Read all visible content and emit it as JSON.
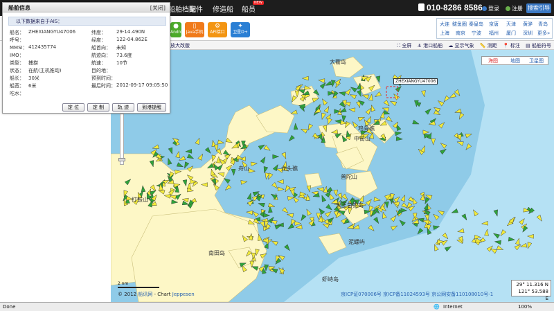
{
  "topbar": {
    "nav": [
      "船舶档案",
      "配件",
      "修造船",
      "船员"
    ],
    "new_badge": "NEW",
    "phone": "010-8286 8586",
    "login": "登录",
    "register": "注册",
    "tour_button": "搜索引导"
  },
  "app_buttons": [
    {
      "label": "Android",
      "color": "#4caa2a",
      "glyph": "●"
    },
    {
      "label": "Java手机",
      "color": "#f07a1a",
      "glyph": "▯"
    },
    {
      "label": "API接口",
      "color": "#f39512",
      "glyph": "⚙"
    },
    {
      "label": "卫星D+",
      "color": "#2a7fd4",
      "glyph": "✦"
    }
  ],
  "cities": {
    "row1": [
      "大连",
      "鲅鱼圈",
      "秦皇岛",
      "京唐",
      "天津",
      "黄骅",
      "青岛"
    ],
    "row2": [
      "上海",
      "南京",
      "宁波",
      "福州",
      "厦门",
      "深圳",
      "更多»"
    ]
  },
  "map_toolbar": {
    "left": "放大改版",
    "items": [
      "全屏",
      "港口船舶",
      "显示气象",
      "测距",
      "标注",
      "船舶符号"
    ]
  },
  "map_type": {
    "options": [
      "海图",
      "地图",
      "卫星图"
    ],
    "selected": "海图"
  },
  "popup": {
    "title": "船舶信息",
    "close": "[关闭]",
    "source": "以下数据来自于AIS：",
    "left_fields": [
      {
        "label": "船名：",
        "value": "ZHEXIANGYU47006"
      },
      {
        "label": "呼号：",
        "value": ""
      },
      {
        "label": "MMSI：",
        "value": "412435774"
      },
      {
        "label": "IMO：",
        "value": ""
      },
      {
        "label": "类型：",
        "value": "捕捞"
      },
      {
        "label": "状态：",
        "value": "在航(主机推动)"
      },
      {
        "label": "船长：",
        "value": "30米"
      },
      {
        "label": "船宽：",
        "value": "6米"
      },
      {
        "label": "吃水：",
        "value": ""
      }
    ],
    "right_fields": [
      {
        "label": "纬度：",
        "value": "29-14.490N"
      },
      {
        "label": "经度：",
        "value": "122-04.862E"
      },
      {
        "label": "船首向：",
        "value": "未知"
      },
      {
        "label": "航迹向：",
        "value": "73.6度"
      },
      {
        "label": "航速：",
        "value": "10节"
      },
      {
        "label": "目的地：",
        "value": ""
      },
      {
        "label": "预到时间：",
        "value": ""
      },
      {
        "label": "最后时间：",
        "value": "2012-09-17 09:05:50"
      }
    ],
    "buttons": [
      "定 位",
      "定 制",
      "轨 迹",
      "到港提醒"
    ]
  },
  "map_labels": {
    "islands": [
      "大衢岛",
      "鸡骨礁",
      "中街山",
      "龙头礁",
      "普陀山",
      "舟山",
      "嵊泗",
      "六横岛",
      "大王首钓岛",
      "泥螺屿",
      "南田岛",
      "打鼓山",
      "虾峙岛",
      "沙鳗屿",
      "檀头山",
      "南韭山"
    ],
    "ship_tag": "ZHEXIANGYU47006"
  },
  "map_controls": {
    "pan_arrows": [
      "↑",
      "←",
      "→",
      "↓"
    ],
    "zoom_in": "+",
    "zoom_out": "−"
  },
  "scale": "2 nm",
  "copyright": {
    "prefix": "© 2012",
    "site": "船讯网",
    "chart": "- Chart",
    "provider": "Jeppesen"
  },
  "icp": "京ICP证070006号 京ICP备11024593号 京公网安备110108010号-1",
  "coords": {
    "lat": "29° 11.316 N",
    "lon": "121° 53.588 E"
  },
  "status": {
    "left": "Done",
    "zone": "Internet",
    "zoom": "100%"
  },
  "colors": {
    "topbar": "#1d1d1d",
    "sea_deep": "#b5e1f4",
    "sea_shallow": "#8fcbe8",
    "land": "#fdf7c6",
    "ship": "#f2ea3a",
    "accent": "#2660b0"
  }
}
